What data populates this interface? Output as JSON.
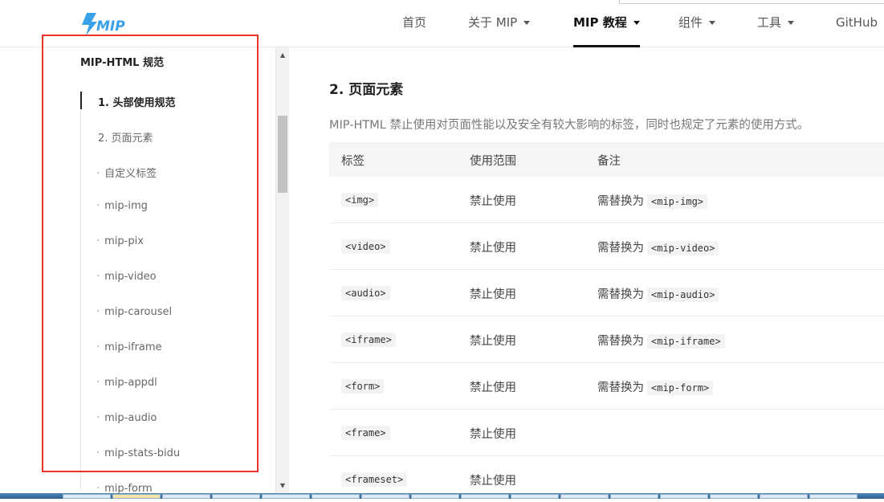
{
  "header": {
    "logo_text": "MIP",
    "nav": [
      {
        "label": "首页",
        "dropdown": false,
        "active": false
      },
      {
        "label": "关于 MIP",
        "dropdown": true,
        "active": false
      },
      {
        "label": "MIP 教程",
        "dropdown": true,
        "active": true
      },
      {
        "label": "组件",
        "dropdown": true,
        "active": false
      },
      {
        "label": "工具",
        "dropdown": true,
        "active": false
      },
      {
        "label": "GitHub",
        "dropdown": false,
        "active": false
      }
    ]
  },
  "sidebar": {
    "title": "MIP-HTML 规范",
    "items": [
      {
        "label": "1. 头部使用规范",
        "active": true,
        "bullet": false
      },
      {
        "label": "2. 页面元素",
        "active": false,
        "bullet": false
      },
      {
        "label": "自定义标签",
        "active": false,
        "bullet": true
      },
      {
        "label": "mip-img",
        "active": false,
        "bullet": true
      },
      {
        "label": "mip-pix",
        "active": false,
        "bullet": true
      },
      {
        "label": "mip-video",
        "active": false,
        "bullet": true
      },
      {
        "label": "mip-carousel",
        "active": false,
        "bullet": true
      },
      {
        "label": "mip-iframe",
        "active": false,
        "bullet": true
      },
      {
        "label": "mip-appdl",
        "active": false,
        "bullet": true
      },
      {
        "label": "mip-audio",
        "active": false,
        "bullet": true
      },
      {
        "label": "mip-stats-bidu",
        "active": false,
        "bullet": true
      },
      {
        "label": "mip-form",
        "active": false,
        "bullet": true
      }
    ],
    "bullet_char": "·"
  },
  "main": {
    "title": "2. 页面元素",
    "intro": "MIP-HTML 禁止使用对页面性能以及安全有较大影响的标签，同时也规定了元素的使用方式。",
    "table": {
      "headers": [
        "标签",
        "使用范围",
        "备注"
      ],
      "rows": [
        {
          "tag": "<img>",
          "scope": "禁止使用",
          "note_prefix": "需替换为",
          "note_code": "<mip-img>"
        },
        {
          "tag": "<video>",
          "scope": "禁止使用",
          "note_prefix": "需替换为",
          "note_code": "<mip-video>"
        },
        {
          "tag": "<audio>",
          "scope": "禁止使用",
          "note_prefix": "需替换为",
          "note_code": "<mip-audio>"
        },
        {
          "tag": "<iframe>",
          "scope": "禁止使用",
          "note_prefix": "需替换为",
          "note_code": "<mip-iframe>"
        },
        {
          "tag": "<form>",
          "scope": "禁止使用",
          "note_prefix": "需替换为",
          "note_code": "<mip-form>"
        },
        {
          "tag": "<frame>",
          "scope": "禁止使用",
          "note_prefix": "",
          "note_code": ""
        },
        {
          "tag": "<frameset>",
          "scope": "禁止使用",
          "note_prefix": "",
          "note_code": ""
        }
      ]
    }
  },
  "colors": {
    "logo_blue": "#3aa0e8",
    "highlight_red": "#e8322c",
    "active_text": "#111111"
  },
  "icons": [
    "logo-bolt-icon",
    "caret-down-icon",
    "scroll-up-arrow-icon",
    "scroll-down-arrow-icon"
  ]
}
